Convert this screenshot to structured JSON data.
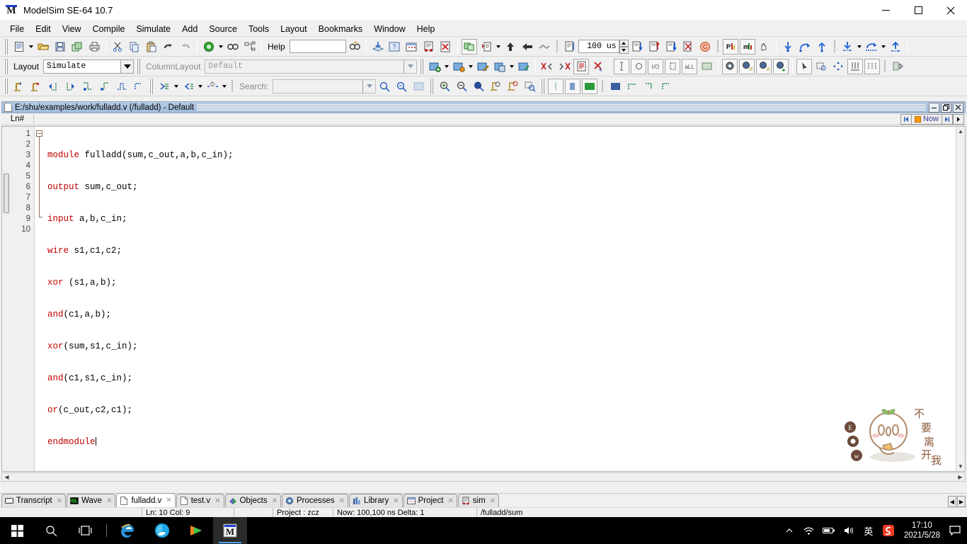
{
  "window": {
    "title": "ModelSim SE-64 10.7",
    "icon": "modelsim-logo-icon",
    "minimize": "minimize-button",
    "maximize": "maximize-button",
    "close": "close-button"
  },
  "menu": {
    "items": [
      {
        "label": "File"
      },
      {
        "label": "Edit"
      },
      {
        "label": "View"
      },
      {
        "label": "Compile"
      },
      {
        "label": "Simulate"
      },
      {
        "label": "Add"
      },
      {
        "label": "Source"
      },
      {
        "label": "Tools"
      },
      {
        "label": "Layout"
      },
      {
        "label": "Bookmarks"
      },
      {
        "label": "Window"
      },
      {
        "label": "Help"
      }
    ]
  },
  "toolbar1": {
    "help_label": "Help",
    "help_value": "",
    "run_length_value": "100 us"
  },
  "toolbar2": {
    "layout_label": "Layout",
    "layout_value": "Simulate",
    "columnlayout_label": "ColumnLayout",
    "columnlayout_value": "Default"
  },
  "toolbar3": {
    "search_label": "Search:",
    "search_value": ""
  },
  "document": {
    "title": "E:/shu/examples/work/fulladd.v (/fulladd) - Default",
    "gutter_header": "Ln#",
    "now_label": "Now",
    "lines": [
      {
        "n": "1",
        "text": "module fulladd(sum,c_out,a,b,c_in);",
        "kw": "module"
      },
      {
        "n": "2",
        "text": "output sum,c_out;",
        "kw": "output"
      },
      {
        "n": "3",
        "text": "input a,b,c_in;",
        "kw": "input"
      },
      {
        "n": "4",
        "text": "wire s1,c1,c2;",
        "kw": "wire"
      },
      {
        "n": "5",
        "text": "xor (s1,a,b);",
        "kw": "xor"
      },
      {
        "n": "6",
        "text": "and(c1,a,b);",
        "kw": "and"
      },
      {
        "n": "7",
        "text": "xor(sum,s1,c_in);",
        "kw": "xor"
      },
      {
        "n": "8",
        "text": "and(c1,s1,c_in);",
        "kw": "and"
      },
      {
        "n": "9",
        "text": "or(c_out,c2,c1);",
        "kw": "or"
      },
      {
        "n": "10",
        "text": "endmodule",
        "kw": "endmodule"
      }
    ]
  },
  "sticker": {
    "text": "不要离开我"
  },
  "tabs": [
    {
      "label": "Transcript",
      "icon": "transcript-icon",
      "active": false
    },
    {
      "label": "Wave",
      "icon": "wave-icon",
      "active": false
    },
    {
      "label": "fulladd.v",
      "icon": "file-icon",
      "active": true
    },
    {
      "label": "test.v",
      "icon": "file-icon",
      "active": false
    },
    {
      "label": "Objects",
      "icon": "objects-icon",
      "active": false
    },
    {
      "label": "Processes",
      "icon": "processes-icon",
      "active": false
    },
    {
      "label": "Library",
      "icon": "library-icon",
      "active": false
    },
    {
      "label": "Project",
      "icon": "project-icon",
      "active": false
    },
    {
      "label": "sim",
      "icon": "sim-icon",
      "active": false
    }
  ],
  "status": {
    "cursor": "Ln:  10  Col:  9",
    "project": "Project : zcz",
    "now": "Now: 100,100 ns  Delta: 1",
    "path": "/fulladd/sum"
  },
  "taskbar": {
    "start": "windows-start-icon",
    "search": "search-icon",
    "taskview": "task-view-icon",
    "apps": [
      {
        "name": "internet-explorer-icon"
      },
      {
        "name": "qq-browser-icon"
      },
      {
        "name": "media-player-icon"
      },
      {
        "name": "modelsim-icon",
        "active": true
      }
    ],
    "tray": {
      "chevron": "^",
      "network": "wifi-icon",
      "battery": "battery-icon",
      "volume": "volume-icon",
      "ime": "英",
      "sogou": "S"
    },
    "time": "17:10",
    "date": "2021/5/28",
    "action_center": "action-center-icon"
  },
  "colors": {
    "keyword": "#c00000",
    "titlebar_gradient_top": "#b6cbe4",
    "accent": "#1a3fd0",
    "now_marker": "#ff9900"
  }
}
